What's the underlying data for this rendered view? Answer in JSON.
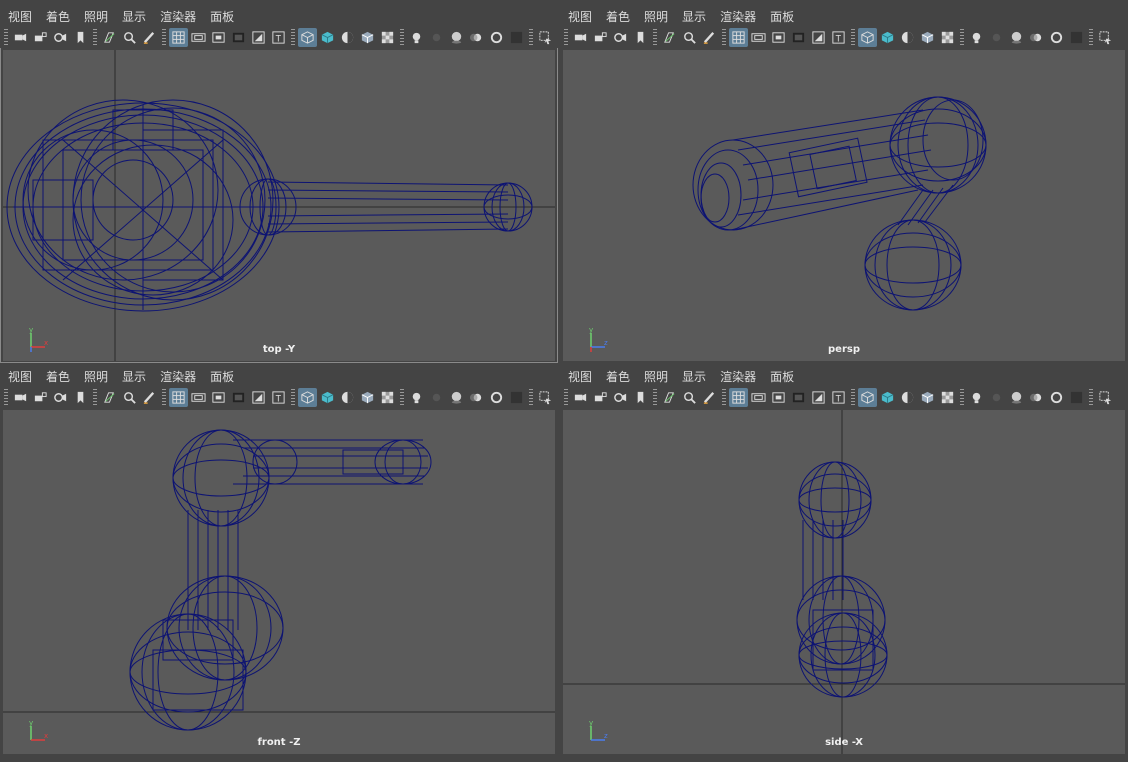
{
  "menu": [
    "视图",
    "着色",
    "照明",
    "显示",
    "渲染器",
    "面板"
  ],
  "panels": [
    {
      "id": "top",
      "label": "top -Y",
      "axes": [
        "y",
        "x",
        "z"
      ],
      "active": true
    },
    {
      "id": "persp",
      "label": "persp",
      "axes": [
        "y",
        "z",
        "x"
      ],
      "active": false
    },
    {
      "id": "front",
      "label": "front -Z",
      "axes": [
        "y",
        "x"
      ],
      "active": false
    },
    {
      "id": "side",
      "label": "side -X",
      "axes": [
        "y",
        "z"
      ],
      "active": false
    }
  ],
  "colors": {
    "wire": "#0d1373",
    "viewport_bg": "#5a5a5a",
    "grid_line": "#2b2b2b",
    "axis_x": "#e03c3c",
    "axis_y": "#6ed36e",
    "axis_z": "#4a7cf0",
    "toolbar_on": "#5d7e96"
  },
  "toolbar_icons": [
    "camera-icon",
    "camera-lock-icon",
    "camera-attributes-icon",
    "bookmark-icon",
    "image-plane-icon",
    "2d-pan-zoom-icon",
    "grease-pencil-icon",
    "grid-icon",
    "film-gate-icon",
    "resolution-gate-icon",
    "gate-mask-icon",
    "field-chart-icon",
    "safe-action-icon",
    "wireframe-icon",
    "smooth-shade-icon",
    "default-material-icon",
    "textured-icon",
    "xray-icon",
    "lights-icon",
    "shadows-icon",
    "ambient-occlusion-icon",
    "motion-blur-icon",
    "anti-alias-icon",
    "depth-of-field-icon",
    "isolate-select-icon"
  ]
}
